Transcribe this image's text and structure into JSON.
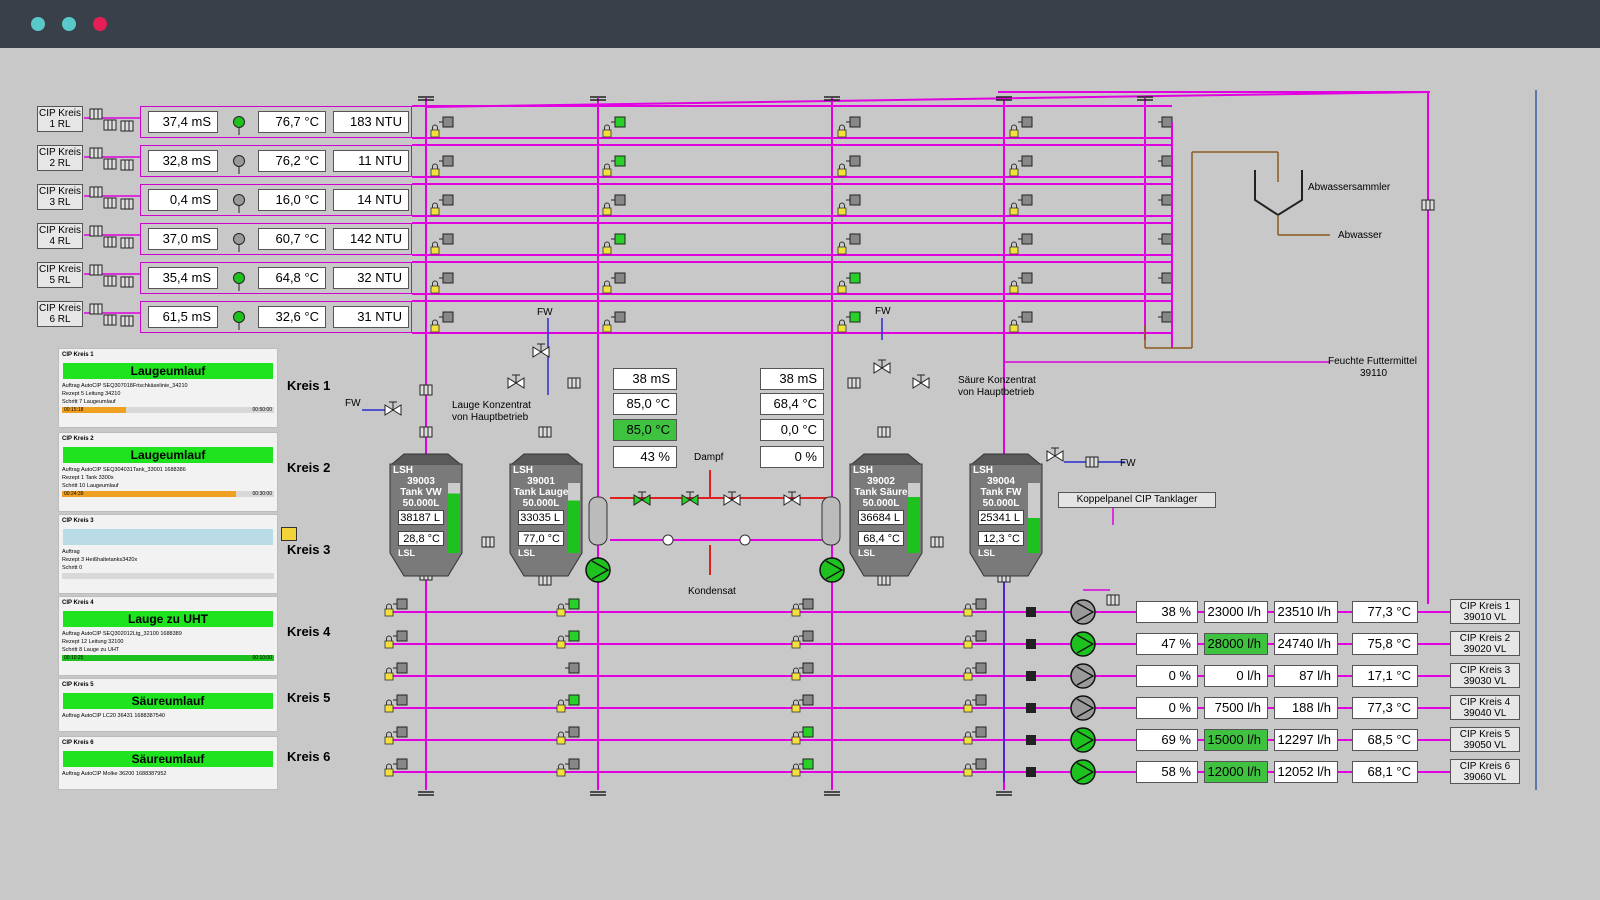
{
  "window": {
    "dots": [
      "#59c9c9",
      "#59c9c9",
      "#e41e57"
    ]
  },
  "colors": {
    "pipe": "#e000e0",
    "water": "#2a2ad0",
    "steam": "#e02020",
    "waste": "#8a5a20",
    "active": "#1ec21e"
  },
  "cip_rows": [
    {
      "label1": "CIP Kreis",
      "label2": "1 RL",
      "ms": "37,4  mS",
      "temp": "76,7  °C",
      "ntu": "183  NTU",
      "ind": "green"
    },
    {
      "label1": "CIP Kreis",
      "label2": "2 RL",
      "ms": "32,8  mS",
      "temp": "76,2  °C",
      "ntu": "11  NTU",
      "ind": "gray"
    },
    {
      "label1": "CIP Kreis",
      "label2": "3 RL",
      "ms": "0,4  mS",
      "temp": "16,0  °C",
      "ntu": "14  NTU",
      "ind": "gray"
    },
    {
      "label1": "CIP Kreis",
      "label2": "4 RL",
      "ms": "37,0  mS",
      "temp": "60,7  °C",
      "ntu": "142  NTU",
      "ind": "gray"
    },
    {
      "label1": "CIP Kreis",
      "label2": "5 RL",
      "ms": "35,4  mS",
      "temp": "64,8  °C",
      "ntu": "32  NTU",
      "ind": "green"
    },
    {
      "label1": "CIP Kreis",
      "label2": "6 RL",
      "ms": "61,5  mS",
      "temp": "32,6  °C",
      "ntu": "31  NTU",
      "ind": "green"
    }
  ],
  "cards": [
    {
      "title": "CIP Kreis 1",
      "status": "Laugeumlauf",
      "l1": "Auftrag     AutoCIP SEQ307018Frischkäselinie_34210",
      "l2": "Rezept     5  Leitung 34210",
      "l3": "Schritt     7  Laugeumlauf",
      "t1": "00:15:18",
      "t2": "00:50:00",
      "progress": 0.3,
      "kreis": "Kreis 1"
    },
    {
      "title": "CIP Kreis 2",
      "status": "Laugeumlauf",
      "l1": "Auftrag     AutoCIP SEQ304031Tank_33001 1688386",
      "l2": "Rezept     1   Tank 3300x",
      "l3": "Schritt     10  Laugeumlauf",
      "t1": "00:24:39",
      "t2": "00:30:00",
      "progress": 0.82,
      "kreis": "Kreis 2"
    },
    {
      "title": "CIP Kreis 3",
      "status": "",
      "l1": "Auftrag",
      "l2": "Rezept     3  Heißhaltetanks3420x",
      "l3": "Schritt     0",
      "t1": "",
      "t2": "",
      "progress": 0,
      "kreis": "Kreis 3"
    },
    {
      "title": "CIP Kreis 4",
      "status": "Lauge zu UHT",
      "l1": "Auftrag     AutoCIP SEQ302012Ltg_32100 1688389",
      "l2": "Rezept     12  Leitung 32100",
      "l3": "Schritt     8   Lauge zu UHT",
      "t1": "00:10:25",
      "t2": "00:10:00",
      "progress": 1.0,
      "kreis": "Kreis 4"
    },
    {
      "title": "CIP Kreis 5",
      "status": "Säureumlauf",
      "l1": "Auftrag     AutoCIP LC20 36431 1688387540",
      "kreis": "Kreis 5"
    },
    {
      "title": "CIP Kreis 6",
      "status": "Säureumlauf",
      "l1": "Auftrag     AutoCIP Molke 36200 1688387952",
      "kreis": "Kreis 6"
    }
  ],
  "tanks": [
    {
      "id": "39003",
      "name": "Tank VW",
      "cap": "50.000L",
      "vol": "38187 L",
      "temp": "28,8 °C",
      "level": 0.85
    },
    {
      "id": "39001",
      "name": "Tank Lauge",
      "cap": "50.000L",
      "vol": "33035 L",
      "temp": "77,0 °C",
      "level": 0.75
    },
    {
      "id": "39002",
      "name": "Tank Säure",
      "cap": "50.000L",
      "vol": "36684 L",
      "temp": "68,4 °C",
      "level": 0.8
    },
    {
      "id": "39004",
      "name": "Tank FW",
      "cap": "50.000L",
      "vol": "25341 L",
      "temp": "12,3 °C",
      "level": 0.5
    }
  ],
  "tank_tags": {
    "lsh": "LSH",
    "lsl": "LSL"
  },
  "center": {
    "left": {
      "ms": "38  mS",
      "t1": "85,0  °C",
      "t2": "85,0  °C",
      "pct": "43 %"
    },
    "right": {
      "ms": "38  mS",
      "t1": "68,4  °C",
      "t2": "0,0  °C",
      "pct": "0 %"
    }
  },
  "labels": {
    "fw": "FW",
    "dampf": "Dampf",
    "kondensat": "Kondensat",
    "lauge1": "Lauge Konzentrat",
    "lauge2": "von Hauptbetrieb",
    "saeure1": "Säure Konzentrat",
    "saeure2": "von Hauptbetrieb",
    "abwassersammler": "Abwassersammler",
    "abwasser": "Abwasser",
    "futter1": "Feuchte Futtermittel",
    "futter2": "39110",
    "koppel": "Koppelpanel CIP Tanklager"
  },
  "vl_rows": [
    {
      "pct": "38 %",
      "sp": "23000 l/h",
      "flow": "23510 l/h",
      "temp": "77,3  °C",
      "vl1": "CIP Kreis 1",
      "vl2": "39010 VL",
      "pump": "gray"
    },
    {
      "pct": "47 %",
      "sp": "28000 l/h",
      "flow": "24740 l/h",
      "temp": "75,8  °C",
      "vl1": "CIP Kreis 2",
      "vl2": "39020 VL",
      "pump": "green"
    },
    {
      "pct": "0 %",
      "sp": "0 l/h",
      "flow": "87 l/h",
      "temp": "17,1  °C",
      "vl1": "CIP Kreis 3",
      "vl2": "39030 VL",
      "pump": "gray"
    },
    {
      "pct": "0 %",
      "sp": "7500 l/h",
      "flow": "188 l/h",
      "temp": "77,3  °C",
      "vl1": "CIP Kreis 4",
      "vl2": "39040 VL",
      "pump": "gray"
    },
    {
      "pct": "69 %",
      "sp": "15000 l/h",
      "flow": "12297 l/h",
      "temp": "68,5  °C",
      "vl1": "CIP Kreis 5",
      "vl2": "39050 VL",
      "pump": "green"
    },
    {
      "pct": "58 %",
      "sp": "12000 l/h",
      "flow": "12052 l/h",
      "temp": "68,1  °C",
      "vl1": "CIP Kreis 6",
      "vl2": "39060 VL",
      "pump": "green"
    }
  ],
  "vl_sp_active": [
    false,
    true,
    false,
    false,
    true,
    true
  ]
}
